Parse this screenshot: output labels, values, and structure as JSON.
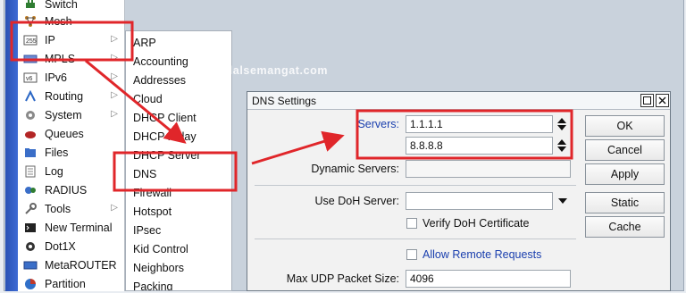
{
  "watermark": "www.modalsemangat.com",
  "sidebar": {
    "items": [
      {
        "label": "Switch",
        "icon": "switch-icon"
      },
      {
        "label": "Mesh",
        "icon": "mesh-icon"
      },
      {
        "label": "IP",
        "icon": "ip-icon",
        "has_submenu": true
      },
      {
        "label": "MPLS",
        "icon": "mpls-icon",
        "has_submenu": true
      },
      {
        "label": "IPv6",
        "icon": "ipv6-icon",
        "has_submenu": true
      },
      {
        "label": "Routing",
        "icon": "routing-icon",
        "has_submenu": true
      },
      {
        "label": "System",
        "icon": "system-icon",
        "has_submenu": true
      },
      {
        "label": "Queues",
        "icon": "queues-icon"
      },
      {
        "label": "Files",
        "icon": "files-icon"
      },
      {
        "label": "Log",
        "icon": "log-icon"
      },
      {
        "label": "RADIUS",
        "icon": "radius-icon"
      },
      {
        "label": "Tools",
        "icon": "tools-icon",
        "has_submenu": true
      },
      {
        "label": "New Terminal",
        "icon": "terminal-icon"
      },
      {
        "label": "Dot1X",
        "icon": "dot1x-icon"
      },
      {
        "label": "MetaROUTER",
        "icon": "metarouter-icon"
      },
      {
        "label": "Partition",
        "icon": "partition-icon"
      }
    ]
  },
  "submenu": {
    "items": [
      "ARP",
      "Accounting",
      "Addresses",
      "Cloud",
      "DHCP Client",
      "DHCP Relay",
      "DHCP Server",
      "DNS",
      "Firewall",
      "Hotspot",
      "IPsec",
      "Kid Control",
      "Neighbors",
      "Packing"
    ]
  },
  "dialog": {
    "title": "DNS Settings",
    "servers_label": "Servers:",
    "servers": [
      "1.1.1.1",
      "8.8.8.8"
    ],
    "dynamic_servers_label": "Dynamic Servers:",
    "dynamic_servers_value": "",
    "doh_server_label": "Use DoH Server:",
    "doh_server_value": "",
    "verify_doh_label": "Verify DoH Certificate",
    "verify_doh_checked": false,
    "allow_remote_label": "Allow Remote Requests",
    "allow_remote_checked": false,
    "max_udp_label": "Max UDP Packet Size:",
    "max_udp_value": "4096",
    "buttons": {
      "ok": "OK",
      "cancel": "Cancel",
      "apply": "Apply",
      "static": "Static",
      "cache": "Cache"
    }
  },
  "colors": {
    "annotation_red": "#e0262a",
    "servers_label_blue": "#1a3fae",
    "allow_remote_blue": "#1a3fae",
    "sidebar_strip": "#2a52b4"
  }
}
